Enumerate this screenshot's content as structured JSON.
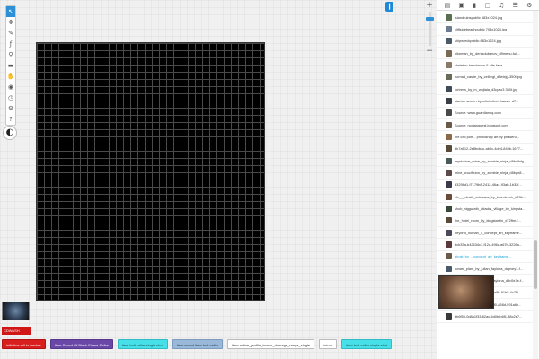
{
  "toolbar": {
    "tools": [
      {
        "name": "select-tool",
        "icon": "cursor-icon",
        "glyph": "↖",
        "active": true
      },
      {
        "name": "move-tool",
        "icon": "move-icon",
        "glyph": "✥",
        "active": false
      },
      {
        "name": "draw-tool",
        "icon": "pencil-icon",
        "glyph": "✎",
        "active": false
      },
      {
        "name": "text-tool",
        "icon": "text-icon",
        "glyph": "ƒ",
        "active": false
      },
      {
        "name": "zoom-tool",
        "icon": "magnifier-icon",
        "glyph": "⚲",
        "active": false
      },
      {
        "name": "ruler-tool",
        "icon": "ruler-icon",
        "glyph": "▬",
        "active": false
      },
      {
        "name": "hand-tool",
        "icon": "hand-icon",
        "glyph": "✋",
        "active": false
      },
      {
        "name": "fog-tool",
        "icon": "eye-icon",
        "glyph": "◉",
        "active": false
      },
      {
        "name": "turn-tool",
        "icon": "clock-icon",
        "glyph": "◷",
        "active": false
      },
      {
        "name": "settings-tool",
        "icon": "cog-icon",
        "glyph": "⚙",
        "active": false
      },
      {
        "name": "help-tool",
        "icon": "help-icon",
        "glyph": "?",
        "active": false
      }
    ],
    "theme_glyph": "◐"
  },
  "top_marker": {
    "glyph": "❙"
  },
  "zoom": {
    "plus": "+",
    "minus": "−",
    "level_fraction": 0.18
  },
  "sidebar": {
    "tabs": [
      {
        "name": "tab-chat",
        "icon": "chat-icon",
        "glyph": "▤"
      },
      {
        "name": "tab-art",
        "icon": "image-icon",
        "glyph": "▣"
      },
      {
        "name": "tab-journal",
        "icon": "book-icon",
        "glyph": "▮"
      },
      {
        "name": "tab-compendium",
        "icon": "document-icon",
        "glyph": "▢"
      },
      {
        "name": "tab-jukebox",
        "icon": "music-icon",
        "glyph": "♫"
      },
      {
        "name": "tab-collections",
        "icon": "list-icon",
        "glyph": "☰"
      },
      {
        "name": "tab-settings",
        "icon": "gear-icon",
        "glyph": "⚙"
      }
    ],
    "items": [
      {
        "label": "islandruinspublic 683x1024.jpg",
        "color": "#5b6f52"
      },
      {
        "label": "cliffsidebeachpublic 703x1024.jpg",
        "color": "#6d7d8f"
      },
      {
        "label": "shipwreckpublic 683x1024.jpg",
        "color": "#4b5a66"
      },
      {
        "label": "pikeman_by_denisdubanov_d9menu-full...",
        "color": "#7a6a58"
      },
      {
        "label": "skeleton-henchman-6-idle-face",
        "color": "#8a7a68"
      },
      {
        "label": "nomad_castle_by_cellergi_d8etxjg-350t.jpg",
        "color": "#6a6a5a"
      },
      {
        "label": "fortress_by_m_wojtala_d3quro3 350t.jpg",
        "color": "#3e4a56"
      },
      {
        "label": "startup screen by mitchellnetrhauser d7...",
        "color": "#3a3f45"
      },
      {
        "label": "Source: www.guardianhq.com",
        "color": "#4a4a4a"
      },
      {
        "label": "Source: novianquest.blogspot.com",
        "color": "#6a5a4a"
      },
      {
        "label": "the lost port... photoshop art by phaseru...",
        "color": "#8a6a48"
      },
      {
        "label": "db7a512-2e8bcbac-ab0c-4de4-849b-1677...",
        "color": "#5a4a3a"
      },
      {
        "label": "mystorbar_mine_by_zombie_ninja_d8bq6rfg...",
        "color": "#4a5a5a"
      },
      {
        "label": "mine_crucifixion_by_zombie_ninja_d8bgn8...",
        "color": "#5a4a4a"
      },
      {
        "label": "d3298d1-f7179b8-2412-46a4-93ab-1b32f...",
        "color": "#3a3a4a"
      },
      {
        "label": "vfx___death_colossus_by_bramleech_d23b...",
        "color": "#6a4a3a"
      },
      {
        "label": "shub_niggurath_attacks_village_by_kingsta...",
        "color": "#3a4a3a"
      },
      {
        "label": "the_hotel_room_by_kingstantin_d72ftm-f...",
        "color": "#5a4a3a"
      },
      {
        "label": "beyond_human_4_concept_art_keyframe...",
        "color": "#4a4a5a"
      },
      {
        "label": "dcb33a-b42634c1-f12a-496c-a67b-3226a...",
        "color": "#5a3a3a"
      },
      {
        "label": "ghost_by_...concept_art_keyframe...",
        "color": "#6a5a4a",
        "selected": true
      },
      {
        "label": "power_plant_by_julian_faylona_dapvey1-f...",
        "color": "#4a5a6a"
      },
      {
        "label": "central_node_by_julian_faylona_d8n5x7e-f...",
        "color": "#3a4a5a"
      },
      {
        "label": "db6f53-12a6d6d5-3b8a-4a8b-91b5-4c7f1...",
        "color": "#5a5a4a"
      },
      {
        "label": "db6f54-c14b0d12-9f7f-49f0-a58d-591a6b...",
        "color": "#4a3a4a"
      },
      {
        "label": "db6f55-0d8a1f33-62ac-4d0b-b6f1-88c2e7...",
        "color": "#3a3a3a"
      }
    ]
  },
  "player": {
    "name": "CDWASH"
  },
  "macros": [
    {
      "label": "initiative roll to tracker",
      "bg": "#d91e1e",
      "fg": "#ffffff",
      "border": "#b31212"
    },
    {
      "label": "Item Sword Of Black Flame Strike",
      "bg": "#6a48a8",
      "fg": "#ffffff",
      "border": "#55388a"
    },
    {
      "label": "item bolt caller single shot",
      "bg": "#48e0e8",
      "fg": "#0f4a50",
      "border": "#2fbcc4"
    },
    {
      "label": "item sword item bolt caller",
      "bg": "#9ab8d8",
      "fg": "#1d3450",
      "border": "#7b9cc0"
    },
    {
      "label": "item active_profile_bonus_damage_range_single",
      "bg": "#ffffff",
      "fg": "#333333",
      "border": "#bbbbbb"
    },
    {
      "label": "intron",
      "bg": "#ffffff",
      "fg": "#555555",
      "border": "#bbbbbb"
    },
    {
      "label": "item bolt caller single shot",
      "bg": "#48e0e8",
      "fg": "#0f4a50",
      "border": "#2fbcc4"
    }
  ]
}
